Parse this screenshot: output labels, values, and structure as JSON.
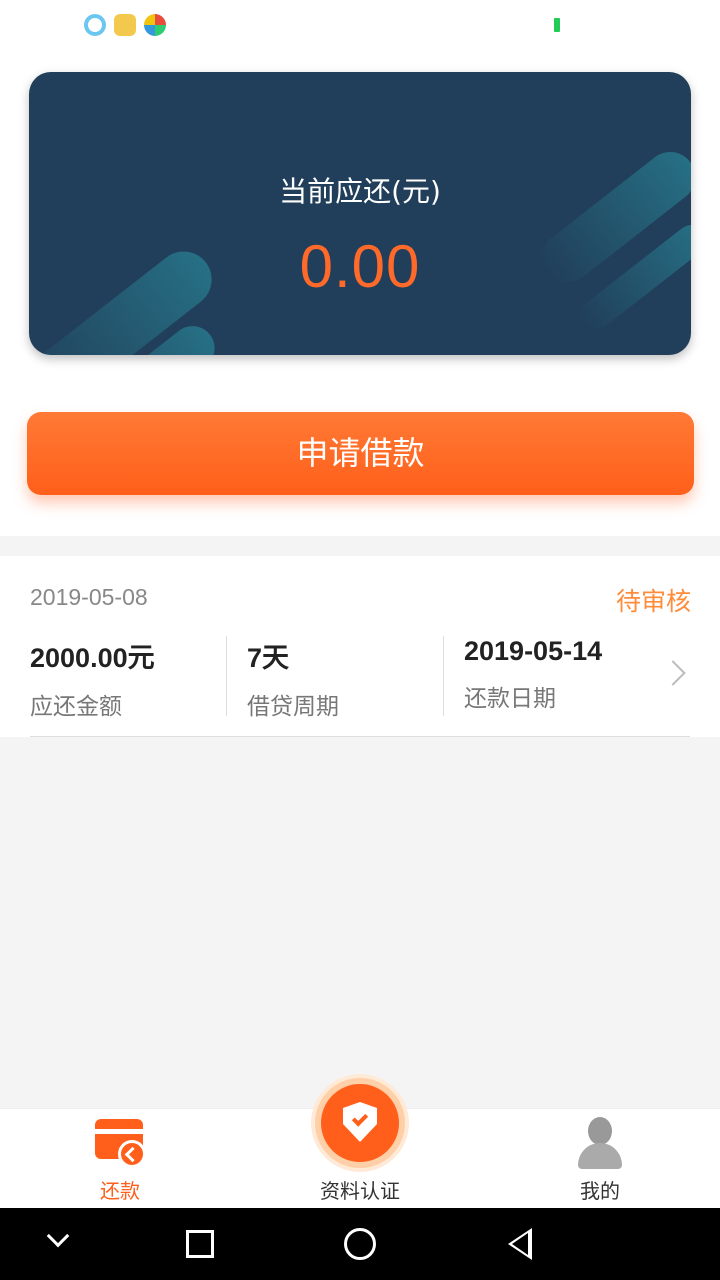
{
  "status_bar": {
    "icons": [
      "qq-browser-icon",
      "app-icon",
      "color-wheel-icon"
    ],
    "signal_color": "#22cc55"
  },
  "balance_card": {
    "label": "当前应还(元)",
    "amount": "0.00"
  },
  "apply_button": {
    "label": "申请借款"
  },
  "loan": {
    "date": "2019-05-08",
    "status": "待审核",
    "columns": [
      {
        "value": "2000.00元",
        "label": "应还金额"
      },
      {
        "value": "7天",
        "label": "借贷周期"
      },
      {
        "value": "2019-05-14",
        "label": "还款日期"
      }
    ]
  },
  "tabs": [
    {
      "label": "还款",
      "icon": "repay-card-icon",
      "active": true
    },
    {
      "label": "资料认证",
      "icon": "shield-check-icon",
      "active": false
    },
    {
      "label": "我的",
      "icon": "user-icon",
      "active": false
    }
  ],
  "nav": [
    "chevron-down-icon",
    "recent-apps-icon",
    "home-icon",
    "back-icon"
  ],
  "colors": {
    "accent": "#ff5f1a",
    "card_bg": "#213f5a",
    "status_pending": "#ff8c3a"
  }
}
